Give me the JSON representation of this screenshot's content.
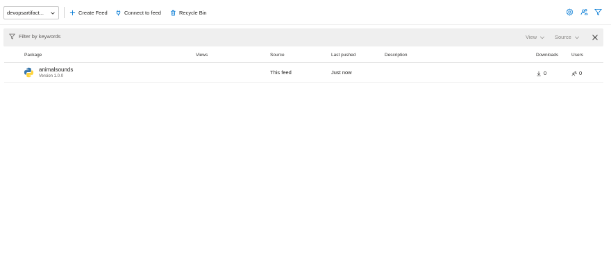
{
  "toolbar": {
    "feed_select_label": "devopsartifact...",
    "create_feed_label": "Create Feed",
    "connect_label": "Connect to feed",
    "recycle_label": "Recycle Bin",
    "icons": [
      "chevron-down-icon",
      "plus-icon",
      "plug-icon",
      "recycle-bin-icon",
      "settings-gear-icon",
      "permissions-icon",
      "filter-icon"
    ]
  },
  "filterbar": {
    "placeholder": "Filter by keywords",
    "view_label": "View",
    "source_label": "Source"
  },
  "table": {
    "columns": {
      "package": "Package",
      "views": "Views",
      "source": "Source",
      "last_pushed": "Last pushed",
      "description": "Description",
      "downloads": "Downloads",
      "users": "Users"
    },
    "rows": [
      {
        "name": "animalsounds",
        "version": "Version 1.0.0",
        "views": "",
        "source": "This feed",
        "last_pushed": "Just now",
        "description": "",
        "downloads": "0",
        "users": "0",
        "icon": "python-icon"
      }
    ]
  },
  "colors": {
    "accent": "#0078d4",
    "filter_bg": "#efefef",
    "python_blue": "#3776ab",
    "python_yellow": "#ffd43b"
  }
}
